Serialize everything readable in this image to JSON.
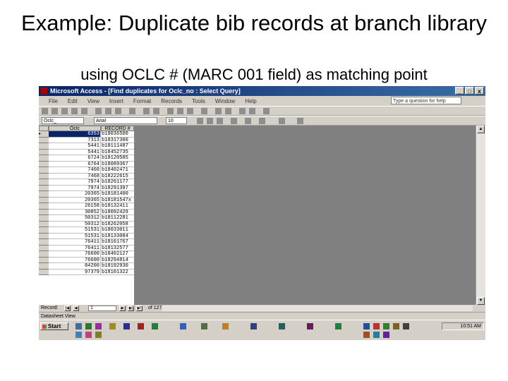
{
  "slide": {
    "title": "Example: Duplicate bib records at branch library",
    "subtitle": "using OCLC # (MARC 001 field) as matching point"
  },
  "window": {
    "title": "Microsoft Access - [Find duplicates for Oclc_no : Select Query]",
    "controls": [
      "_",
      "□",
      "x"
    ]
  },
  "menu": [
    "File",
    "Edit",
    "View",
    "Insert",
    "Format",
    "Records",
    "Tools",
    "Window",
    "Help"
  ],
  "ask_placeholder": "Type a question for help",
  "toolbar": {
    "combo1": "Oclc_",
    "combo2": "Arial",
    "combo3": "10"
  },
  "datasheet": {
    "columns": [
      "Oclc",
      "RECORD #(BIB"
    ],
    "rows": [
      [
        "6353",
        "b18036500"
      ],
      [
        "7313",
        "b18317300"
      ],
      [
        "5441",
        "b18111487"
      ],
      [
        "5441",
        "b18452735"
      ],
      [
        "6724",
        "b18120585"
      ],
      [
        "6764",
        "b18089367"
      ],
      [
        "7460",
        "b18402471"
      ],
      [
        "7468",
        "b18222615"
      ],
      [
        "7974",
        "b18261177"
      ],
      [
        "7974",
        "b18291397"
      ],
      [
        "20365",
        "b18181400"
      ],
      [
        "20365",
        "b18181547x"
      ],
      [
        "26158",
        "b18132411"
      ],
      [
        "30852",
        "b18092429"
      ],
      [
        "50312",
        "b18112281"
      ],
      [
        "50312",
        "b18262058"
      ],
      [
        "51531",
        "b18033011"
      ],
      [
        "51531",
        "b18133084"
      ],
      [
        "76411",
        "b18161767"
      ],
      [
        "76411",
        "b18132577"
      ],
      [
        "76600",
        "b18402127"
      ],
      [
        "76600",
        "b18294814"
      ],
      [
        "84200",
        "b18192930"
      ],
      [
        "97379",
        "b18101322"
      ]
    ]
  },
  "nav": {
    "label": "Record:",
    "current": "1",
    "of_text": "of 127"
  },
  "status": "Datasheet View",
  "taskbar": {
    "start": "Start",
    "clock": "10:51 AM"
  }
}
